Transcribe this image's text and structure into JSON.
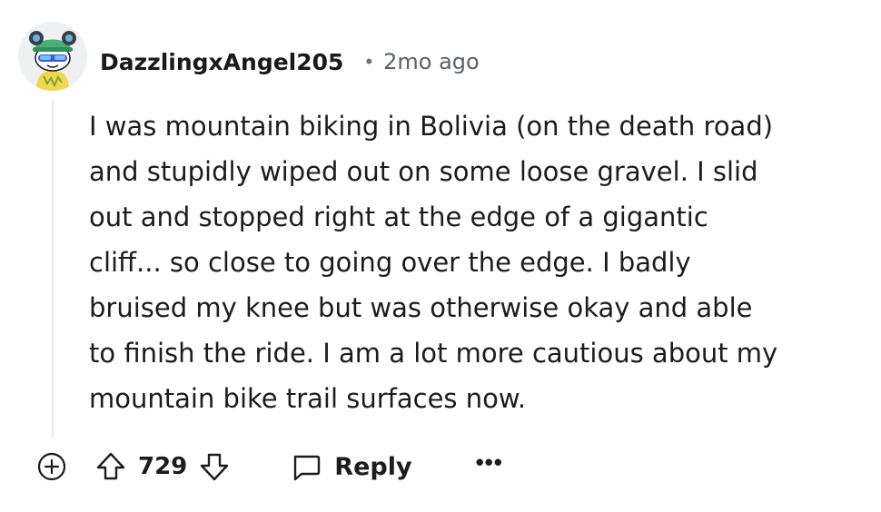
{
  "comment": {
    "username": "DazzlingxAngel205",
    "separator": "•",
    "timestamp": "2mo ago",
    "body": "I was mountain biking in Bolivia (on the death road)\nand stupidly wiped out on some loose gravel. I slid\nout and stopped right at the edge of a gigantic\ncliff... so close to going over the edge. I badly\nbruised my knee but was otherwise okay and able\nto finish the ride. I am a lot more cautious about my\nmountain bike trail surfaces now.",
    "avatar_icon": "snoo-avatar-icon"
  },
  "actions": {
    "expand_icon": "plus-circle-icon",
    "upvote_icon": "upvote-arrow-icon",
    "score": "729",
    "downvote_icon": "downvote-arrow-icon",
    "reply_icon": "speech-bubble-icon",
    "reply_label": "Reply",
    "more_label": "•••"
  },
  "colors": {
    "text": "#1c1c1c",
    "meta": "#5c6166",
    "thread_line": "#e5e7ea",
    "background": "#ffffff"
  }
}
